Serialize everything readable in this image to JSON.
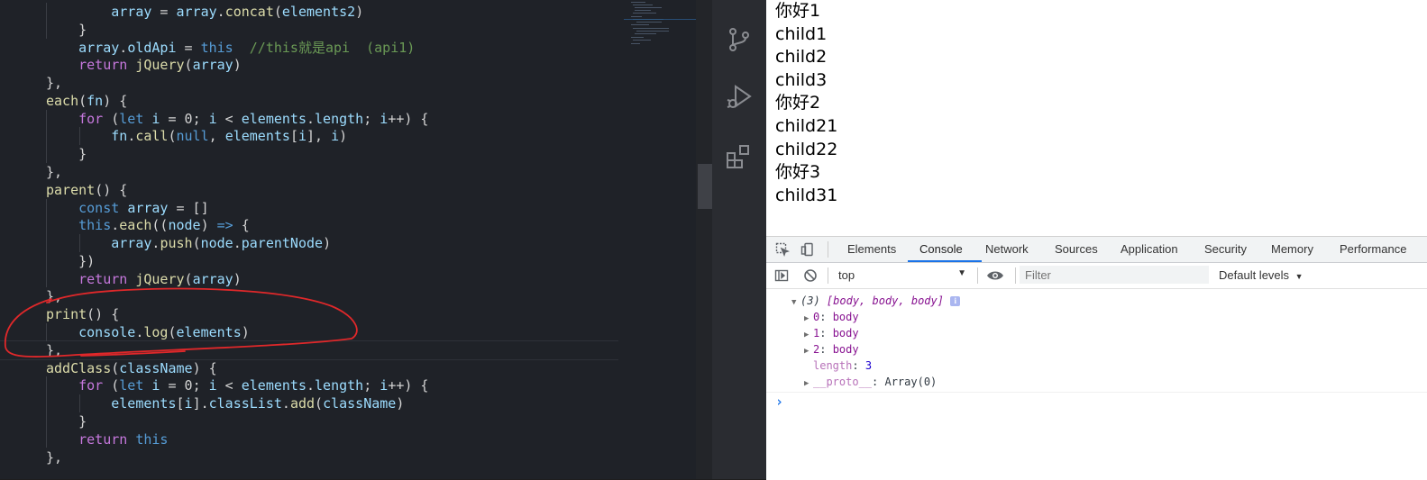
{
  "editor": {
    "lines": [
      [
        [
          "        ",
          "tk-punct"
        ],
        [
          "array",
          "tk-var"
        ],
        [
          " = ",
          "tk-punct"
        ],
        [
          "array",
          "tk-var"
        ],
        [
          ".",
          "tk-punct"
        ],
        [
          "concat",
          "tk-fn"
        ],
        [
          "(",
          "tk-punct"
        ],
        [
          "elements2",
          "tk-var"
        ],
        [
          ")",
          "tk-punct"
        ]
      ],
      [
        [
          "    }",
          "tk-punct"
        ]
      ],
      [
        [
          "    ",
          "tk-punct"
        ],
        [
          "array",
          "tk-var"
        ],
        [
          ".",
          "tk-punct"
        ],
        [
          "oldApi",
          "tk-var"
        ],
        [
          " = ",
          "tk-punct"
        ],
        [
          "this",
          "tk-kw2"
        ],
        [
          "  ",
          "tk-punct"
        ],
        [
          "//this就是api  (api1)",
          "tk-com"
        ]
      ],
      [
        [
          "    ",
          "tk-punct"
        ],
        [
          "return",
          "tk-kw"
        ],
        [
          " ",
          "tk-punct"
        ],
        [
          "jQuery",
          "tk-fn"
        ],
        [
          "(",
          "tk-punct"
        ],
        [
          "array",
          "tk-var"
        ],
        [
          ")",
          "tk-punct"
        ]
      ],
      [
        [
          "},",
          "tk-punct"
        ]
      ],
      [
        [
          "each",
          "tk-fn"
        ],
        [
          "(",
          "tk-punct"
        ],
        [
          "fn",
          "tk-var"
        ],
        [
          ") {",
          "tk-punct"
        ]
      ],
      [
        [
          "    ",
          "tk-punct"
        ],
        [
          "for",
          "tk-kw"
        ],
        [
          " (",
          "tk-punct"
        ],
        [
          "let",
          "tk-kw2"
        ],
        [
          " ",
          "tk-punct"
        ],
        [
          "i",
          "tk-var"
        ],
        [
          " = ",
          "tk-punct"
        ],
        [
          "0",
          "tk-punct"
        ],
        [
          "; ",
          "tk-punct"
        ],
        [
          "i",
          "tk-var"
        ],
        [
          " < ",
          "tk-punct"
        ],
        [
          "elements",
          "tk-var"
        ],
        [
          ".",
          "tk-punct"
        ],
        [
          "length",
          "tk-var"
        ],
        [
          "; ",
          "tk-punct"
        ],
        [
          "i",
          "tk-var"
        ],
        [
          "++) {",
          "tk-punct"
        ]
      ],
      [
        [
          "        ",
          "tk-punct"
        ],
        [
          "fn",
          "tk-var"
        ],
        [
          ".",
          "tk-punct"
        ],
        [
          "call",
          "tk-fn"
        ],
        [
          "(",
          "tk-punct"
        ],
        [
          "null",
          "tk-kw2"
        ],
        [
          ", ",
          "tk-punct"
        ],
        [
          "elements",
          "tk-var"
        ],
        [
          "[",
          "tk-punct"
        ],
        [
          "i",
          "tk-var"
        ],
        [
          "], ",
          "tk-punct"
        ],
        [
          "i",
          "tk-var"
        ],
        [
          ")",
          "tk-punct"
        ]
      ],
      [
        [
          "    }",
          "tk-punct"
        ]
      ],
      [
        [
          "},",
          "tk-punct"
        ]
      ],
      [
        [
          "parent",
          "tk-fn"
        ],
        [
          "() {",
          "tk-punct"
        ]
      ],
      [
        [
          "    ",
          "tk-punct"
        ],
        [
          "const",
          "tk-kw2"
        ],
        [
          " ",
          "tk-punct"
        ],
        [
          "array",
          "tk-var"
        ],
        [
          " = []",
          "tk-punct"
        ]
      ],
      [
        [
          "    ",
          "tk-punct"
        ],
        [
          "this",
          "tk-kw2"
        ],
        [
          ".",
          "tk-punct"
        ],
        [
          "each",
          "tk-fn"
        ],
        [
          "((",
          "tk-punct"
        ],
        [
          "node",
          "tk-var"
        ],
        [
          ") ",
          "tk-punct"
        ],
        [
          "=>",
          "tk-kw2"
        ],
        [
          " {",
          "tk-punct"
        ]
      ],
      [
        [
          "        ",
          "tk-punct"
        ],
        [
          "array",
          "tk-var"
        ],
        [
          ".",
          "tk-punct"
        ],
        [
          "push",
          "tk-fn"
        ],
        [
          "(",
          "tk-punct"
        ],
        [
          "node",
          "tk-var"
        ],
        [
          ".",
          "tk-punct"
        ],
        [
          "parentNode",
          "tk-var"
        ],
        [
          ")",
          "tk-punct"
        ]
      ],
      [
        [
          "    })",
          "tk-punct"
        ]
      ],
      [
        [
          "    ",
          "tk-punct"
        ],
        [
          "return",
          "tk-kw"
        ],
        [
          " ",
          "tk-punct"
        ],
        [
          "jQuery",
          "tk-fn"
        ],
        [
          "(",
          "tk-punct"
        ],
        [
          "array",
          "tk-var"
        ],
        [
          ")",
          "tk-punct"
        ]
      ],
      [
        [
          "},",
          "tk-punct"
        ]
      ],
      [
        [
          "print",
          "tk-fn"
        ],
        [
          "() {",
          "tk-punct"
        ]
      ],
      [
        [
          "    ",
          "tk-punct"
        ],
        [
          "console",
          "tk-var"
        ],
        [
          ".",
          "tk-punct"
        ],
        [
          "log",
          "tk-fn"
        ],
        [
          "(",
          "tk-punct"
        ],
        [
          "elements",
          "tk-var"
        ],
        [
          ")",
          "tk-punct"
        ]
      ],
      [
        [
          "},",
          "tk-punct"
        ]
      ],
      [
        [
          "addClass",
          "tk-fn"
        ],
        [
          "(",
          "tk-punct"
        ],
        [
          "className",
          "tk-var"
        ],
        [
          ") {",
          "tk-punct"
        ]
      ],
      [
        [
          "    ",
          "tk-punct"
        ],
        [
          "for",
          "tk-kw"
        ],
        [
          " (",
          "tk-punct"
        ],
        [
          "let",
          "tk-kw2"
        ],
        [
          " ",
          "tk-punct"
        ],
        [
          "i",
          "tk-var"
        ],
        [
          " = ",
          "tk-punct"
        ],
        [
          "0",
          "tk-punct"
        ],
        [
          "; ",
          "tk-punct"
        ],
        [
          "i",
          "tk-var"
        ],
        [
          " < ",
          "tk-punct"
        ],
        [
          "elements",
          "tk-var"
        ],
        [
          ".",
          "tk-punct"
        ],
        [
          "length",
          "tk-var"
        ],
        [
          "; ",
          "tk-punct"
        ],
        [
          "i",
          "tk-var"
        ],
        [
          "++) {",
          "tk-punct"
        ]
      ],
      [
        [
          "        ",
          "tk-punct"
        ],
        [
          "elements",
          "tk-var"
        ],
        [
          "[",
          "tk-punct"
        ],
        [
          "i",
          "tk-var"
        ],
        [
          "].",
          "tk-punct"
        ],
        [
          "classList",
          "tk-var"
        ],
        [
          ".",
          "tk-punct"
        ],
        [
          "add",
          "tk-fn"
        ],
        [
          "(",
          "tk-punct"
        ],
        [
          "className",
          "tk-var"
        ],
        [
          ")",
          "tk-punct"
        ]
      ],
      [
        [
          "    }",
          "tk-punct"
        ]
      ],
      [
        [
          "    ",
          "tk-punct"
        ],
        [
          "return",
          "tk-kw"
        ],
        [
          " ",
          "tk-punct"
        ],
        [
          "this",
          "tk-kw2"
        ]
      ],
      [
        [
          "},",
          "tk-punct"
        ]
      ]
    ],
    "annotation_color": "#e0282a"
  },
  "activity_icons": [
    "source-control-icon",
    "run-debug-icon",
    "extensions-icon"
  ],
  "page": {
    "lines": [
      "你好1",
      "child1",
      "child2",
      "child3",
      "你好2",
      "child21",
      "child22",
      "你好3",
      "child31"
    ]
  },
  "devtools": {
    "tabs": [
      "Elements",
      "Console",
      "Network",
      "Sources",
      "Application",
      "Security",
      "Memory",
      "Performance"
    ],
    "active_tab": "Console",
    "context": "top",
    "filter_placeholder": "Filter",
    "levels": "Default levels",
    "console": {
      "summary_count": "(3)",
      "summary_items": "[body, body, body]",
      "info_badge": "i",
      "entries": [
        {
          "key": "0",
          "value": "body"
        },
        {
          "key": "1",
          "value": "body"
        },
        {
          "key": "2",
          "value": "body"
        }
      ],
      "length_key": "length",
      "length_value": "3",
      "proto_key": "__proto__",
      "proto_value": "Array(0)",
      "prompt": "›"
    },
    "accent": "#1a73e8"
  }
}
